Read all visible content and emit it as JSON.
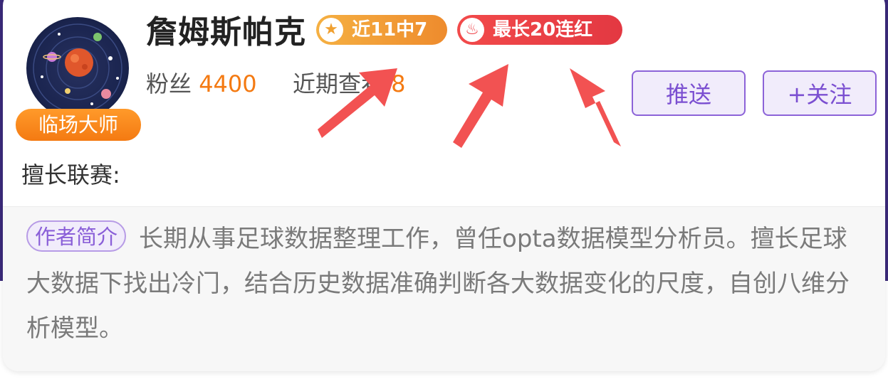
{
  "profile": {
    "name": "詹姆斯帕克",
    "badge": "临场大师",
    "recent_record": "近11中7",
    "streak": "最长20连红",
    "fans_label": "粉丝",
    "fans_count": "4400",
    "recent_views_label": "近期查看",
    "recent_views_count": "8",
    "leagues_label": "擅长联赛:"
  },
  "actions": {
    "push_label": "推送",
    "follow_label": "+关注"
  },
  "intro": {
    "tag": "作者简介",
    "text": "长期从事足球数据整理工作，曾任opta数据模型分析员。擅长足球大数据下找出冷门，结合历史数据准确判断各大数据变化的尺度，自创八维分析模型。"
  },
  "colors": {
    "accent_orange": "#f47a12",
    "accent_red": "#ef3f45",
    "accent_purple": "#8c63d8",
    "annotation_arrow": "#f25252"
  },
  "icons": {
    "recent_record": "star-icon",
    "streak": "flame-icon"
  }
}
